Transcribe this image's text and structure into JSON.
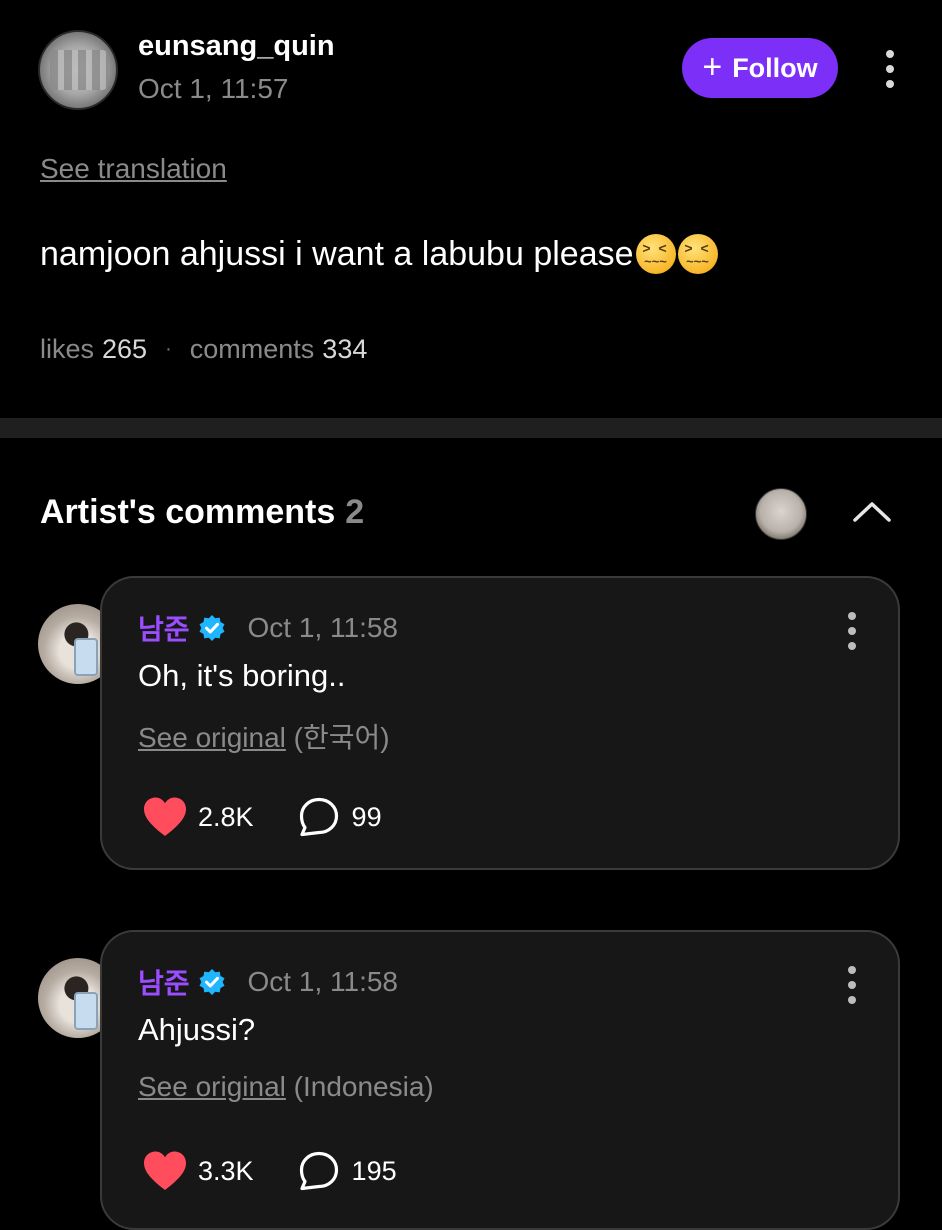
{
  "post": {
    "username": "eunsang_quin",
    "time": "Oct 1, 11:57",
    "follow_label": "Follow",
    "see_translation": "See translation",
    "body": "namjoon ahjussi i want a labubu please",
    "likes_label": "likes",
    "likes": "265",
    "separator": "·",
    "comments_label": "comments",
    "comments": "334"
  },
  "artist_comments": {
    "title": "Artist's comments",
    "count": "2",
    "items": [
      {
        "name": "남준",
        "time": "Oct 1, 11:58",
        "text": "Oh, it's boring..",
        "see_original": "See original",
        "language": "(한국어)",
        "likes": "2.8K",
        "replies": "99"
      },
      {
        "name": "남준",
        "time": "Oct 1, 11:58",
        "text": "Ahjussi?",
        "see_original": "See original",
        "language": "(Indonesia)",
        "likes": "3.3K",
        "replies": "195"
      }
    ]
  },
  "colors": {
    "accent": "#7b2ff7",
    "artist_name": "#9b4dff",
    "heart": "#ff4d5e",
    "verified": "#1fb6ff"
  },
  "icons": [
    "plus-icon",
    "more-vertical-icon",
    "chevron-up-icon",
    "verified-icon",
    "heart-icon",
    "comment-bubble-icon"
  ]
}
